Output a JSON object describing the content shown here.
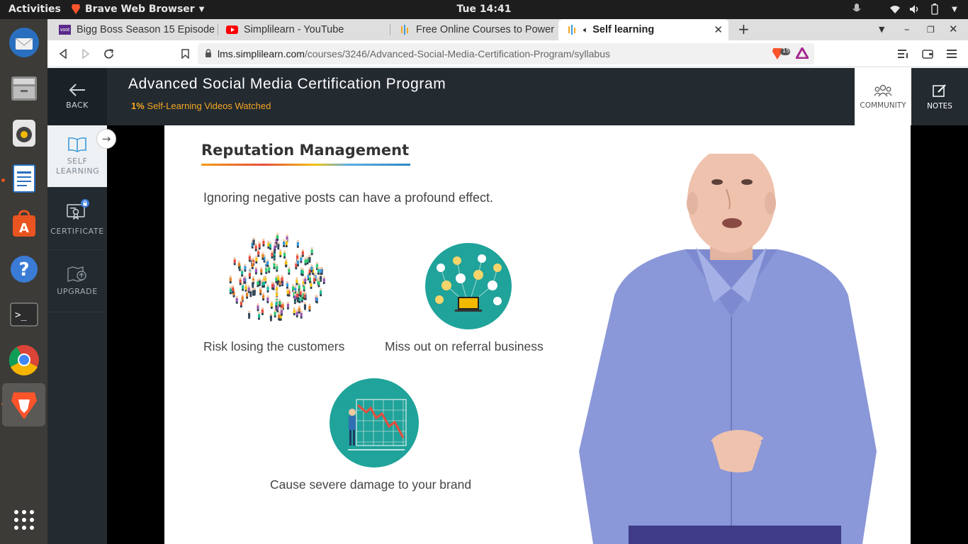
{
  "system": {
    "activities": "Activities",
    "app_name": "Brave Web Browser",
    "clock": "Tue 14:41"
  },
  "browser": {
    "tabs": [
      {
        "label": "Bigg Boss Season 15 Episode",
        "favicon": "voot-icon"
      },
      {
        "label": "Simplilearn - YouTube",
        "favicon": "youtube-icon"
      },
      {
        "label": "Free Online Courses to Power",
        "favicon": "simplilearn-icon"
      },
      {
        "label": "Self learning",
        "favicon": "simplilearn-icon",
        "active": true
      }
    ],
    "url_host": "lms.simplilearn.com",
    "url_path": "/courses/3246/Advanced-Social-Media-Certification-Program/syllabus",
    "shield_count": "15"
  },
  "header": {
    "back_label": "BACK",
    "course_title": "Advanced Social Media Certification Program",
    "progress_percent": "1%",
    "progress_label": " Self-Learning Videos Watched",
    "community_label": "COMMUNITY",
    "notes_label": "NOTES"
  },
  "sidebar": {
    "items": [
      {
        "label": "SELF LEARNING",
        "icon": "book-icon"
      },
      {
        "label": "CERTIFICATE",
        "icon": "certificate-icon"
      },
      {
        "label": "UPGRADE",
        "icon": "upgrade-icon"
      }
    ]
  },
  "slide": {
    "title": "Reputation Management",
    "intro": "Ignoring negative posts can have a profound effect.",
    "points": [
      "Risk losing the customers",
      "Miss out on referral business",
      "Cause severe damage to your brand"
    ]
  },
  "colors": {
    "accent": "#f5a623",
    "header_bg": "#232a30",
    "teal": "#1fa39a"
  }
}
